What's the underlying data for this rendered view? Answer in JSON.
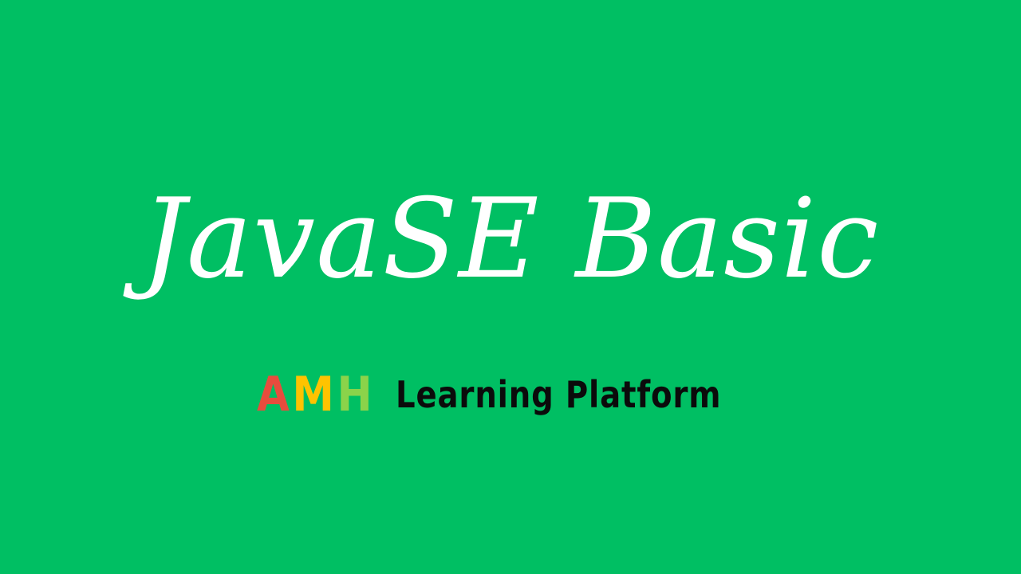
{
  "slide": {
    "title": "JavaSE Basic",
    "background_color": "#00BF63",
    "title_color": "#FFFFFF"
  },
  "brand": {
    "logo_letters": [
      {
        "letter": "A",
        "color": "#E84C3D"
      },
      {
        "letter": "M",
        "color": "#FFC300"
      },
      {
        "letter": "H",
        "color": "#8BD34A"
      }
    ],
    "platform_text": "Learning Platform",
    "platform_text_color": "#0B0B0B"
  }
}
